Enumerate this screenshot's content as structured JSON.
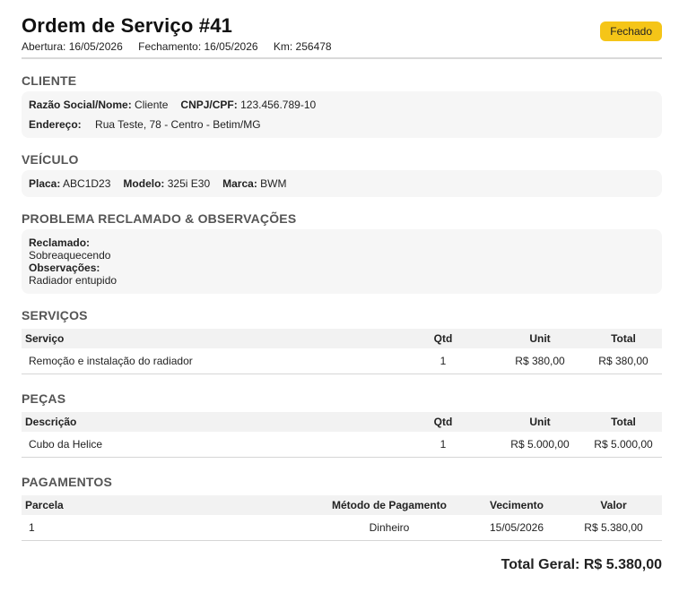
{
  "header": {
    "title": "Ordem de Serviço #41",
    "abertura": "Abertura: 16/05/2026",
    "fechamento": "Fechamento: 16/05/2026",
    "km": "Km: 256478",
    "status": "Fechado",
    "status_color": "#f5c518"
  },
  "cliente": {
    "section_title": "CLIENTE",
    "razao_label": "Razão Social/Nome:",
    "razao_value": "Cliente",
    "cnpj_label": "CNPJ/CPF:",
    "cnpj_value": "123.456.789-10",
    "endereco_label": "Endereço:",
    "endereco_value": "Rua Teste, 78 - Centro - Betim/MG"
  },
  "veiculo": {
    "section_title": "VEÍCULO",
    "placa_label": "Placa:",
    "placa_value": "ABC1D23",
    "modelo_label": "Modelo:",
    "modelo_value": "325i E30",
    "marca_label": "Marca:",
    "marca_value": "BWM"
  },
  "problema": {
    "section_title": "PROBLEMA RECLAMADO & OBSERVAÇÕES",
    "reclamado_label": "Reclamado:",
    "reclamado_value": "Sobreaquecendo",
    "observacoes_label": "Observações:",
    "observacoes_value": "Radiador entupido"
  },
  "servicos": {
    "section_title": "SERVIÇOS",
    "headers": [
      "Serviço",
      "Qtd",
      "Unit",
      "Total"
    ],
    "rows": [
      [
        "Remoção e instalação do radiador",
        "1",
        "R$ 380,00",
        "R$ 380,00"
      ]
    ]
  },
  "pecas": {
    "section_title": "PEÇAS",
    "headers": [
      "Descrição",
      "Qtd",
      "Unit",
      "Total"
    ],
    "rows": [
      [
        "Cubo da Helice",
        "1",
        "R$ 5.000,00",
        "R$ 5.000,00"
      ]
    ]
  },
  "pagamentos": {
    "section_title": "PAGAMENTOS",
    "headers": [
      "Parcela",
      "Método de Pagamento",
      "Vecimento",
      "Valor"
    ],
    "rows": [
      [
        "1",
        "Dinheiro",
        "15/05/2026",
        "R$ 5.380,00"
      ]
    ]
  },
  "total_geral": "Total Geral: R$ 5.380,00"
}
